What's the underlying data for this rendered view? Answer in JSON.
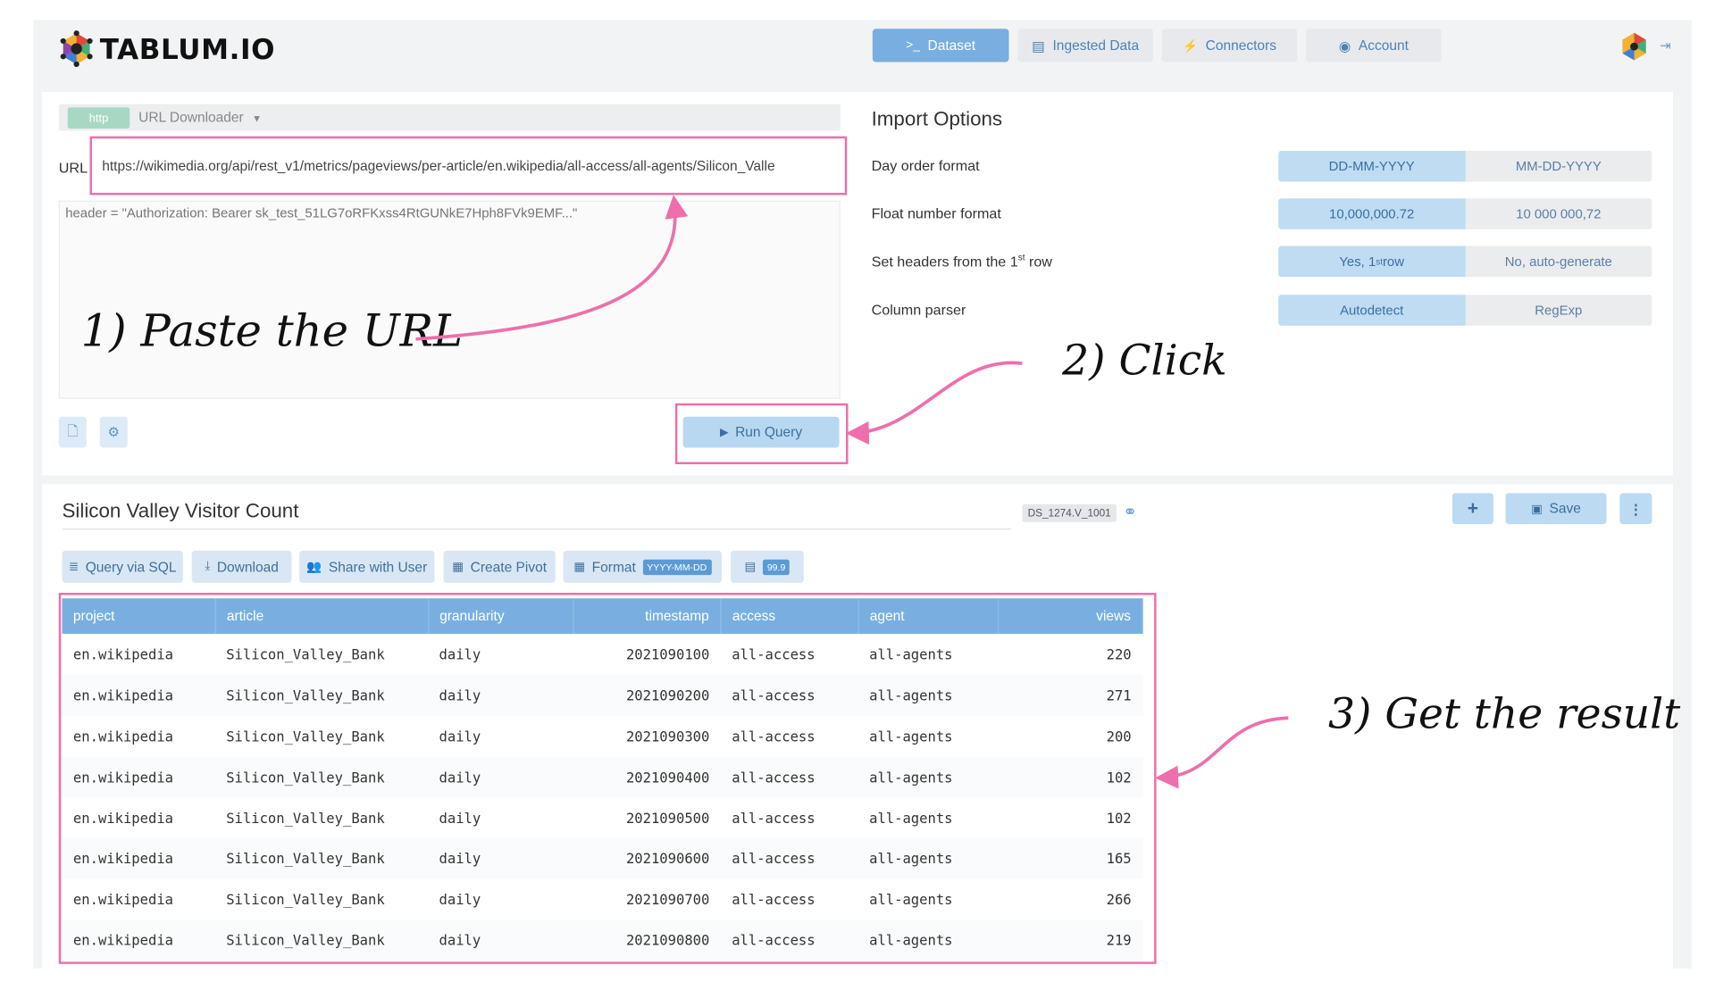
{
  "brand": {
    "name": "TABLUM.IO"
  },
  "nav": [
    {
      "label": "Dataset",
      "icon": ">_"
    },
    {
      "label": "Ingested Data",
      "icon": "▤"
    },
    {
      "label": "Connectors",
      "icon": "🔌"
    },
    {
      "label": "Account",
      "icon": "◉"
    }
  ],
  "source": {
    "tag": "http",
    "connector": "URL Downloader",
    "url_label": "URL",
    "url": "https://wikimedia.org/api/rest_v1/metrics/pageviews/per-article/en.wikipedia/all-access/all-agents/Silicon_Valle",
    "header_text": "header = \"Authorization: Bearer sk_test_51LG7oRFKxss4RtGUNkE7Hph8FVk9EMF...\"",
    "run_label": "Run Query"
  },
  "options": {
    "title": "Import Options",
    "day_order_label": "Day order format",
    "day_order": [
      "DD-MM-YYYY",
      "MM-DD-YYYY"
    ],
    "float_label": "Float number format",
    "float": [
      "10,000,000.72",
      "10 000 000,72"
    ],
    "headers_label_pre": "Set headers from the 1",
    "headers_label_sup": "st",
    "headers_label_post": " row",
    "headers_yes_pre": "Yes, 1",
    "headers_yes_sup": "st",
    "headers_yes_post": " row",
    "headers_no": "No, auto-generate",
    "parser_label": "Column parser",
    "parser": [
      "Autodetect",
      "RegExp"
    ]
  },
  "dataset": {
    "title": "Silicon Valley Visitor Count",
    "id": "DS_1274.V_1001",
    "save_label": "Save",
    "add_label": "+",
    "tools": {
      "sql": "Query via SQL",
      "download": "Download",
      "share": "Share with User",
      "pivot": "Create Pivot",
      "format": "Format",
      "format_tag": "YYYY-MM-DD",
      "number_tag": "99.9"
    }
  },
  "table": {
    "columns": [
      "project",
      "article",
      "granularity",
      "timestamp",
      "access",
      "agent",
      "views"
    ],
    "rows": [
      [
        "en.wikipedia",
        "Silicon_Valley_Bank",
        "daily",
        "2021090100",
        "all-access",
        "all-agents",
        "220"
      ],
      [
        "en.wikipedia",
        "Silicon_Valley_Bank",
        "daily",
        "2021090200",
        "all-access",
        "all-agents",
        "271"
      ],
      [
        "en.wikipedia",
        "Silicon_Valley_Bank",
        "daily",
        "2021090300",
        "all-access",
        "all-agents",
        "200"
      ],
      [
        "en.wikipedia",
        "Silicon_Valley_Bank",
        "daily",
        "2021090400",
        "all-access",
        "all-agents",
        "102"
      ],
      [
        "en.wikipedia",
        "Silicon_Valley_Bank",
        "daily",
        "2021090500",
        "all-access",
        "all-agents",
        "102"
      ],
      [
        "en.wikipedia",
        "Silicon_Valley_Bank",
        "daily",
        "2021090600",
        "all-access",
        "all-agents",
        "165"
      ],
      [
        "en.wikipedia",
        "Silicon_Valley_Bank",
        "daily",
        "2021090700",
        "all-access",
        "all-agents",
        "266"
      ],
      [
        "en.wikipedia",
        "Silicon_Valley_Bank",
        "daily",
        "2021090800",
        "all-access",
        "all-agents",
        "219"
      ]
    ]
  },
  "annotations": {
    "step1": "1) Paste the URL",
    "step2": "2) Click",
    "step3": "3) Get the result",
    "color": "#ee6fab"
  },
  "colors": {
    "accent": "#78afe0",
    "highlight": "#ee6fab"
  }
}
